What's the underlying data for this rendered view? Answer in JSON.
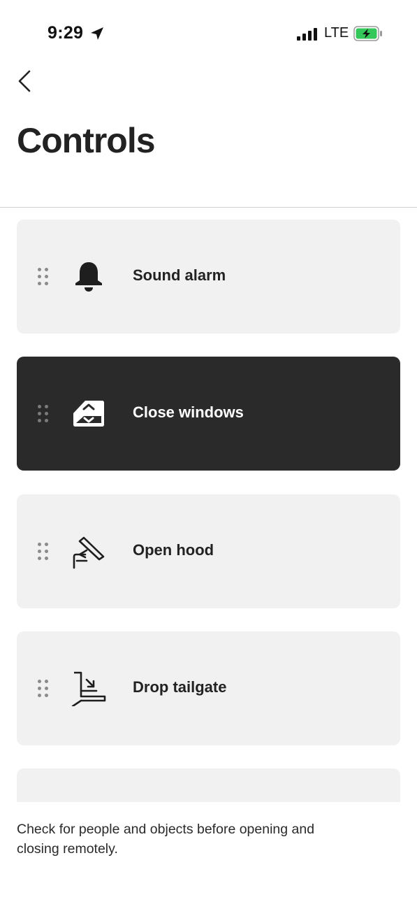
{
  "status_bar": {
    "time": "9:29",
    "network": "LTE",
    "icons": {
      "location": "location-arrow-icon",
      "signal": "cellular-signal-icon",
      "battery": "battery-charging-icon"
    },
    "battery_color": "#34c759"
  },
  "header": {
    "back_icon": "chevron-left-icon",
    "title": "Controls"
  },
  "controls": [
    {
      "label": "Sound alarm",
      "icon": "bell-icon",
      "active": false
    },
    {
      "label": "Close windows",
      "icon": "window-icon",
      "active": true
    },
    {
      "label": "Open hood",
      "icon": "hood-icon",
      "active": false
    },
    {
      "label": "Drop tailgate",
      "icon": "tailgate-icon",
      "active": false
    },
    {
      "label": "",
      "icon": "",
      "active": false
    }
  ],
  "colors": {
    "card_background": "#f1f1f1",
    "active_card_background": "#2a2a2a",
    "text": "#222222"
  },
  "footer": {
    "note": "Check for people and objects before opening and closing remotely."
  }
}
